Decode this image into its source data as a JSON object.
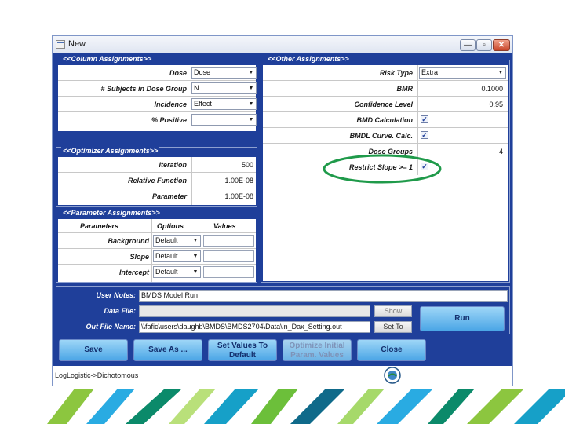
{
  "window": {
    "title": "New",
    "minimize": "—",
    "maximize": "▫",
    "close": "✕"
  },
  "column_assignments": {
    "title": "<<Column Assignments>>",
    "rows": [
      {
        "label": "Dose",
        "value": "Dose"
      },
      {
        "label": "# Subjects in Dose Group",
        "value": "N"
      },
      {
        "label": "Incidence",
        "value": "Effect"
      },
      {
        "label": "% Positive",
        "value": ""
      }
    ]
  },
  "other_assignments": {
    "title": "<<Other Assignments>>",
    "risk_type": {
      "label": "Risk Type",
      "value": "Extra"
    },
    "bmr": {
      "label": "BMR",
      "value": "0.1000"
    },
    "confidence": {
      "label": "Confidence Level",
      "value": "0.95"
    },
    "bmd_calc": {
      "label": "BMD Calculation",
      "checked": true
    },
    "bmdl_curve": {
      "label": "BMDL Curve. Calc.",
      "checked": true
    },
    "dose_groups": {
      "label": "Dose Groups",
      "value": "4"
    },
    "restrict_slope": {
      "label": "Restrict Slope >= 1",
      "checked": true
    }
  },
  "optimizer": {
    "title": "<<Optimizer Assignments>>",
    "rows": [
      {
        "label": "Iteration",
        "value": "500"
      },
      {
        "label": "Relative Function",
        "value": "1.00E-08"
      },
      {
        "label": "Parameter",
        "value": "1.00E-08"
      }
    ]
  },
  "parameter_assignments": {
    "title": "<<Parameter Assignments>>",
    "headers": [
      "Parameters",
      "Options",
      "Values"
    ],
    "rows": [
      {
        "name": "Background",
        "option": "Default",
        "value": ""
      },
      {
        "name": "Slope",
        "option": "Default",
        "value": ""
      },
      {
        "name": "Intercept",
        "option": "Default",
        "value": ""
      }
    ]
  },
  "notes": {
    "user_notes_label": "User Notes:",
    "user_notes_value": "BMDS Model Run",
    "data_file_label": "Data File:",
    "data_file_value": "",
    "show_label": "Show",
    "out_file_label": "Out File Name:",
    "out_file_value": "\\\\fafic\\users\\daughb\\BMDS\\BMDS2704\\Data\\ln_Dax_Setting.out",
    "set_to_label": "Set To",
    "run_label": "Run"
  },
  "buttons": {
    "save": "Save",
    "save_as": "Save As ...",
    "set_default_1": "Set Values To",
    "set_default_2": "Default",
    "optimize_1": "Optimize Initial",
    "optimize_2": "Param. Values",
    "close": "Close"
  },
  "status_bar": {
    "text": "LogLogistic->Dichotomous"
  },
  "colors": {
    "panel_blue": "#1f3f9a",
    "button_blue": "#4ba6e6",
    "highlight_ellipse": "#1f9a4a"
  }
}
